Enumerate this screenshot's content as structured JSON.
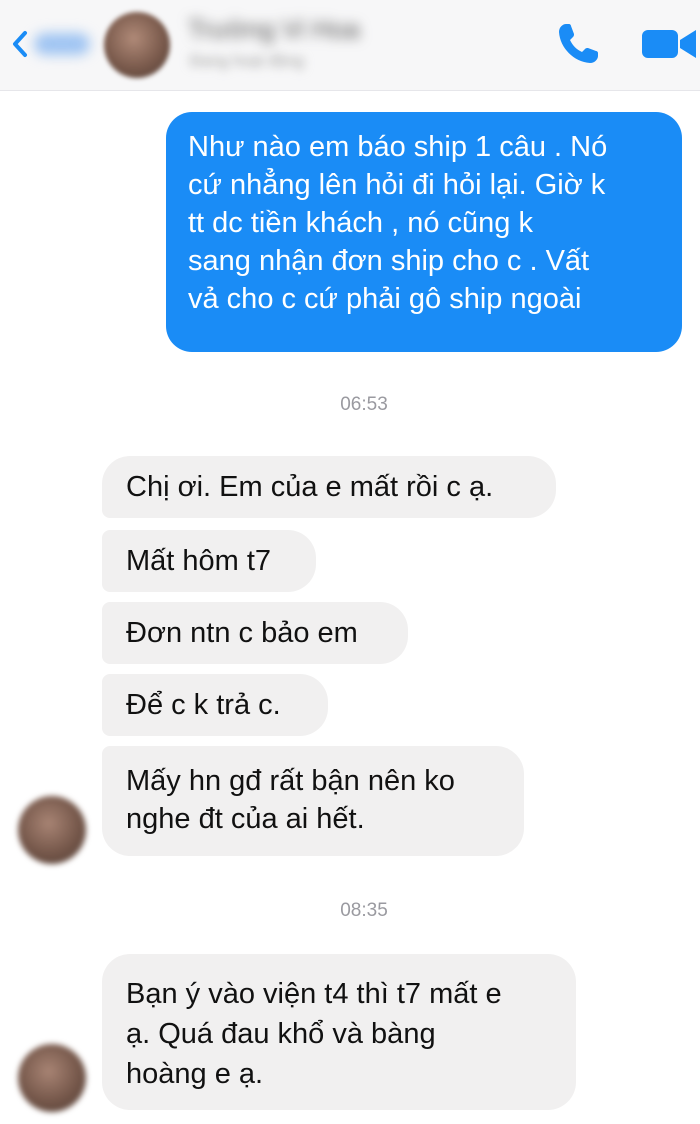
{
  "header": {
    "contact_name": "Trường Vi Hoa",
    "contact_status": "Đang hoạt động",
    "back_icon": "chevron-left-icon",
    "call_icon": "phone-icon",
    "video_icon": "video-camera-icon",
    "accent_color": "#1a8cf6"
  },
  "messages": {
    "outgoing": [
      {
        "lines": [
          "Như nào em báo ship 1 câu . Nó",
          "cứ nhẳng lên hỏi đi hỏi lại. Giờ k",
          "tt dc tiền khách , nó cũng k",
          "sang nhận đơn ship cho c . Vất",
          "vả cho c cứ phải gô ship ngoài"
        ]
      }
    ],
    "timestamp_1": "06:53",
    "group_1": [
      "Chị ơi. Em của e mất rồi c ạ.",
      "Mất hôm t7",
      "Đơn ntn c bảo em",
      "Để c k trả c."
    ],
    "group_1_last_lines": [
      "Mấy hn gđ rất bận nên ko",
      "nghe đt của ai hết."
    ],
    "timestamp_2": "08:35",
    "group_2_lines": [
      "Bạn ý vào viện t4 thì t7 mất e",
      "ạ. Quá đau khổ và bàng",
      "hoàng e ạ."
    ],
    "bubble_color_incoming": "#f1f0f0",
    "bubble_color_outgoing": "#1a8cf6"
  }
}
